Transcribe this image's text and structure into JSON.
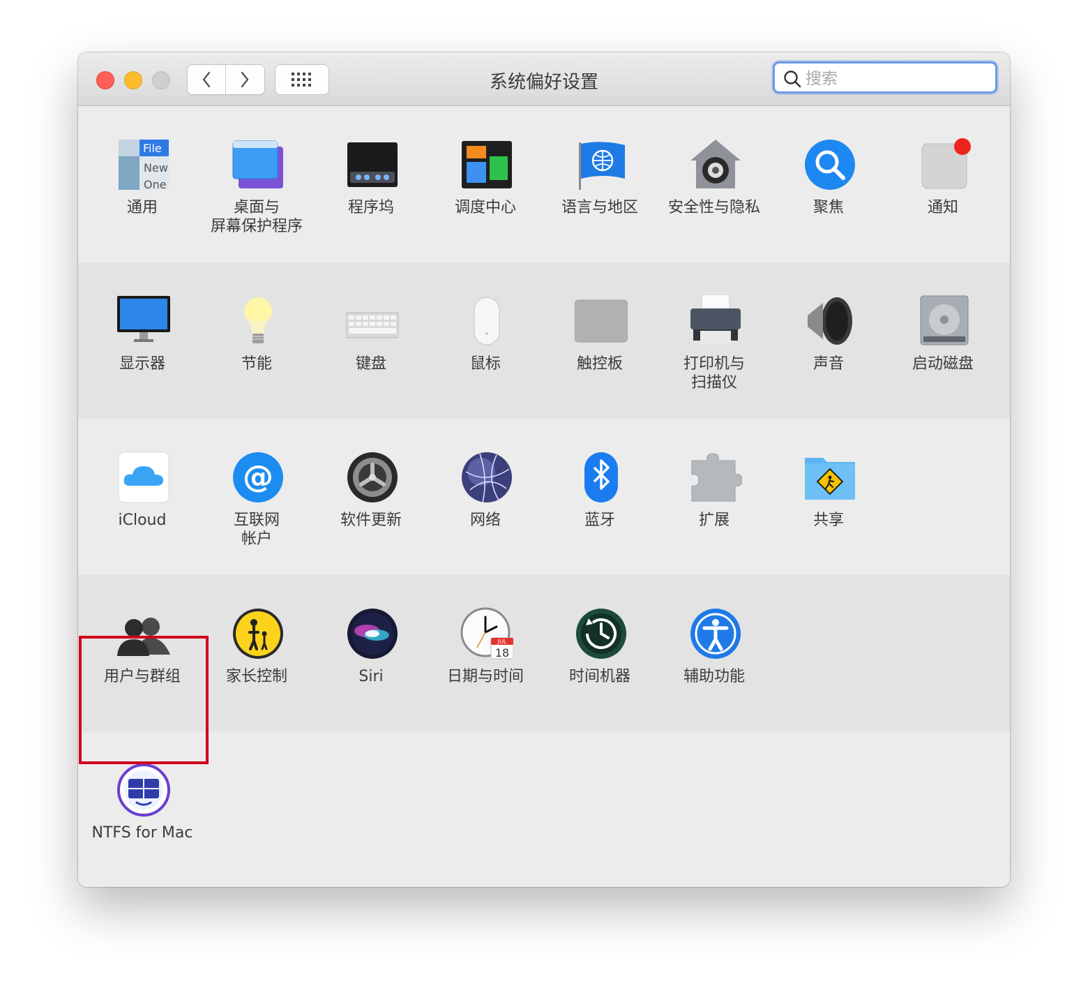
{
  "window": {
    "title": "系统偏好设置"
  },
  "search": {
    "placeholder": "搜索",
    "value": ""
  },
  "rows": [
    [
      {
        "label": "通用",
        "icon": "general-icon"
      },
      {
        "label": "桌面与\n屏幕保护程序",
        "icon": "desktop-screensaver-icon"
      },
      {
        "label": "程序坞",
        "icon": "dock-icon"
      },
      {
        "label": "调度中心",
        "icon": "mission-control-icon"
      },
      {
        "label": "语言与地区",
        "icon": "language-region-icon"
      },
      {
        "label": "安全性与隐私",
        "icon": "security-privacy-icon"
      },
      {
        "label": "聚焦",
        "icon": "spotlight-icon"
      },
      {
        "label": "通知",
        "icon": "notifications-icon"
      }
    ],
    [
      {
        "label": "显示器",
        "icon": "display-icon"
      },
      {
        "label": "节能",
        "icon": "energy-saver-icon"
      },
      {
        "label": "键盘",
        "icon": "keyboard-icon"
      },
      {
        "label": "鼠标",
        "icon": "mouse-icon"
      },
      {
        "label": "触控板",
        "icon": "trackpad-icon"
      },
      {
        "label": "打印机与\n扫描仪",
        "icon": "printer-scanner-icon"
      },
      {
        "label": "声音",
        "icon": "sound-icon"
      },
      {
        "label": "启动磁盘",
        "icon": "startup-disk-icon"
      }
    ],
    [
      {
        "label": "iCloud",
        "icon": "icloud-icon"
      },
      {
        "label": "互联网\n帐户",
        "icon": "internet-accounts-icon"
      },
      {
        "label": "软件更新",
        "icon": "software-update-icon"
      },
      {
        "label": "网络",
        "icon": "network-icon"
      },
      {
        "label": "蓝牙",
        "icon": "bluetooth-icon"
      },
      {
        "label": "扩展",
        "icon": "extensions-icon"
      },
      {
        "label": "共享",
        "icon": "sharing-icon"
      }
    ],
    [
      {
        "label": "用户与群组",
        "icon": "users-groups-icon"
      },
      {
        "label": "家长控制",
        "icon": "parental-controls-icon"
      },
      {
        "label": "Siri",
        "icon": "siri-icon"
      },
      {
        "label": "日期与时间",
        "icon": "date-time-icon"
      },
      {
        "label": "时间机器",
        "icon": "time-machine-icon"
      },
      {
        "label": "辅助功能",
        "icon": "accessibility-icon"
      }
    ],
    [
      {
        "label": "NTFS for Mac",
        "icon": "ntfs-for-mac-icon"
      }
    ]
  ],
  "general_icon_text": {
    "line1": "File",
    "line2": "New",
    "line3": "One"
  },
  "calendar_icon_text": {
    "month": "JUL",
    "day": "18"
  },
  "colors": {
    "highlight": "#d0021b",
    "accent": "#6d9ae8",
    "close": "#fe5f57",
    "minimize": "#febb2e"
  }
}
